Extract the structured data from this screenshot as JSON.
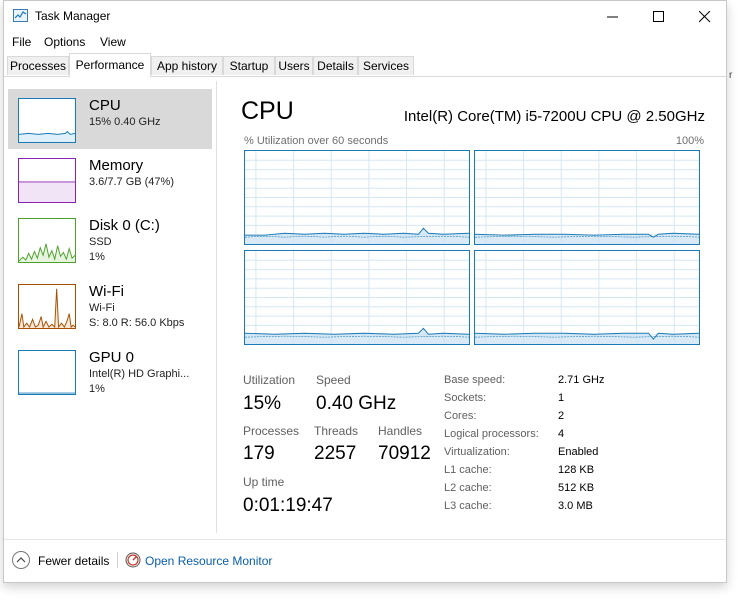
{
  "window": {
    "title": "Task Manager",
    "icons": {
      "app": "task-manager-icon",
      "minimize": "minimize-icon",
      "maximize": "maximize-icon",
      "close": "close-icon"
    }
  },
  "menu": [
    "File",
    "Options",
    "View"
  ],
  "tabs": [
    "Processes",
    "Performance",
    "App history",
    "Startup",
    "Users",
    "Details",
    "Services"
  ],
  "active_tab": "Performance",
  "sidebar": [
    {
      "title": "CPU",
      "line1": "15%  0.40 GHz",
      "line2": "",
      "color": "#1a7ab5",
      "fill": "#dff0fb"
    },
    {
      "title": "Memory",
      "line1": "3.6/7.7 GB (47%)",
      "line2": "",
      "color": "#8b22b2",
      "fill": "#f1e4f7"
    },
    {
      "title": "Disk 0 (C:)",
      "line1": "SSD",
      "line2": "1%",
      "color": "#4da12b",
      "fill": "#e7f4df"
    },
    {
      "title": "Wi-Fi",
      "line1": "Wi-Fi",
      "line2": "S: 8.0  R: 56.0 Kbps",
      "color": "#a74f01",
      "fill": "#f8e8d8"
    },
    {
      "title": "GPU 0",
      "line1": "Intel(R) HD Graphi...",
      "line2": "1%",
      "color": "#1a7ab5",
      "fill": "#dff0fb"
    }
  ],
  "main": {
    "title": "CPU",
    "model": "Intel(R) Core(TM) i5-7200U CPU @ 2.50GHz",
    "graph_caption": "% Utilization over 60 seconds",
    "graph_max": "100%",
    "accent": "#1a7ab5",
    "stats": {
      "utilization_label": "Utilization",
      "utilization": "15%",
      "speed_label": "Speed",
      "speed": "0.40 GHz",
      "processes_label": "Processes",
      "processes": "179",
      "threads_label": "Threads",
      "threads": "2257",
      "handles_label": "Handles",
      "handles": "70912",
      "uptime_label": "Up time",
      "uptime": "0:01:19:47"
    },
    "specs": [
      {
        "label": "Base speed:",
        "value": "2.71 GHz"
      },
      {
        "label": "Sockets:",
        "value": "1"
      },
      {
        "label": "Cores:",
        "value": "2"
      },
      {
        "label": "Logical processors:",
        "value": "4"
      },
      {
        "label": "Virtualization:",
        "value": "Enabled"
      },
      {
        "label": "L1 cache:",
        "value": "128 KB"
      },
      {
        "label": "L2 cache:",
        "value": "512 KB"
      },
      {
        "label": "L3 cache:",
        "value": "3.0 MB"
      }
    ]
  },
  "footer": {
    "fewer_details": "Fewer details",
    "resource_monitor": "Open Resource Monitor",
    "icons": {
      "fewer": "chevron-up-icon",
      "resmon": "resource-monitor-icon"
    }
  },
  "background": {
    "clipped_text": "r"
  }
}
